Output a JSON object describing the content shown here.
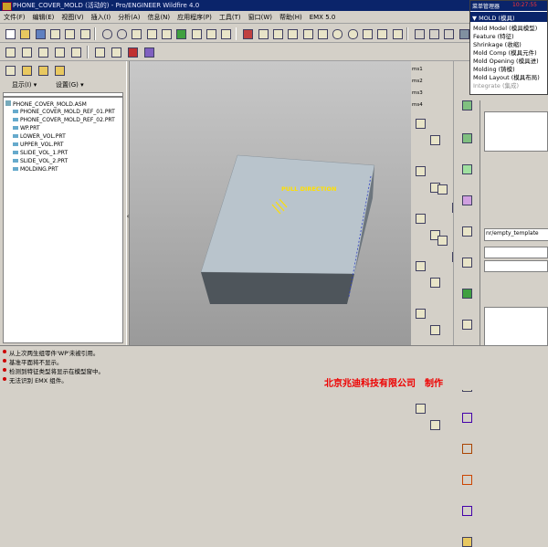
{
  "window": {
    "title": "PHONE_COVER_MOLD (活动的) - Pro/ENGINEER Wildfire 4.0"
  },
  "menubar": {
    "items": [
      "文件(F)",
      "编辑(E)",
      "视图(V)",
      "插入(I)",
      "分析(A)",
      "信息(N)",
      "应用程序(P)",
      "工具(T)",
      "窗口(W)",
      "帮助(H)",
      "EMX 5.0"
    ]
  },
  "left_panel": {
    "tab_show": "显示(I) ▾",
    "tab_settings": "设置(G) ▾",
    "tree_items": [
      "PHONE_COVER_MOLD.ASM",
      "PHONE_COVER_MOLD_REF_01.PRT",
      "PHONE_COVER_MOLD_REF_02.PRT",
      "WP.PRT",
      "LOWER_VOL.PRT",
      "UPPER_VOL.PRT",
      "SLIDE_VOL_1.PRT",
      "SLIDE_VOL_2.PRT",
      "MOLDING.PRT"
    ]
  },
  "viewport": {
    "annotation": "PULL DIRECTION"
  },
  "dropdown_menu": {
    "header": "菜单管理器",
    "time": "10:27:55",
    "title": "▼ MOLD (模具)",
    "items": [
      "Mold Model (模具模型)",
      "Feature (特征)",
      "Shrinkage (收缩)",
      "Mold Comp (模具元件)",
      "Mold Opening (模具进)",
      "Molding (铸模)",
      "Mold Layout (模具布局)",
      "Integrate (集成)"
    ]
  },
  "right_panel": {
    "template_field": "nr/empty_template"
  },
  "side_toolbar_labels": [
    "ms1",
    "ms2",
    "ms3",
    "ms4"
  ],
  "status_messages": [
    "从上次两生组零件'WP'未被引用。",
    "基准平面将不显示。",
    "检测到特征类型将显示在模型窗中。",
    "无法识别 EMX 组件。"
  ],
  "watermark": "北京兆迪科技有限公司　制作",
  "colors": {
    "titlebar": "#0a246a",
    "block_top": "#b9c4cc",
    "block_front": "#4e555b",
    "block_right": "#6d767e",
    "annotation": "#ffe000",
    "watermark": "#e00000"
  }
}
